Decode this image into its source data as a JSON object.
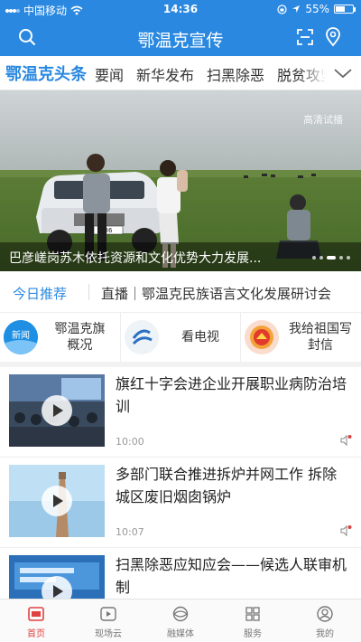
{
  "status_bar": {
    "carrier": "中国移动",
    "time": "14:36",
    "battery": "55%",
    "battery_level": 0.55
  },
  "header": {
    "title": "鄂温克宣传"
  },
  "tabs": [
    {
      "label": "鄂温克头条",
      "active": true
    },
    {
      "label": "要闻"
    },
    {
      "label": "新华发布"
    },
    {
      "label": "扫黑除恶"
    },
    {
      "label": "脱贫攻坚"
    }
  ],
  "banner": {
    "hd_label": "高清试播",
    "caption": "巴彦嵯岗苏木依托资源和文化优势大力发展...",
    "plate": "86"
  },
  "recommend": {
    "label": "今日推荐",
    "text": "直播｜鄂温克民族语言文化发展研讨会"
  },
  "shortcuts": [
    {
      "label": "鄂温克旗\n概况",
      "icon": "news-icon",
      "icon_text": "新闻"
    },
    {
      "label": "看电视",
      "icon": "tv-logo-icon"
    },
    {
      "label": "我给祖国写\n封信",
      "icon": "letter-icon"
    }
  ],
  "news": [
    {
      "title": "旗红十字会进企业开展职业病防治培训",
      "time": "10:00"
    },
    {
      "title": "多部门联合推进拆炉并网工作 拆除城区废旧烟囱锅炉",
      "time": "10:07"
    },
    {
      "title": "扫黑除恶应知应会——候选人联审机制",
      "time": ""
    }
  ],
  "bottom_nav": [
    {
      "label": "首页",
      "active": true
    },
    {
      "label": "现场云"
    },
    {
      "label": "融媒体"
    },
    {
      "label": "服务"
    },
    {
      "label": "我的"
    }
  ],
  "colors": {
    "primary": "#2a88e0",
    "active_nav": "#e04141"
  }
}
